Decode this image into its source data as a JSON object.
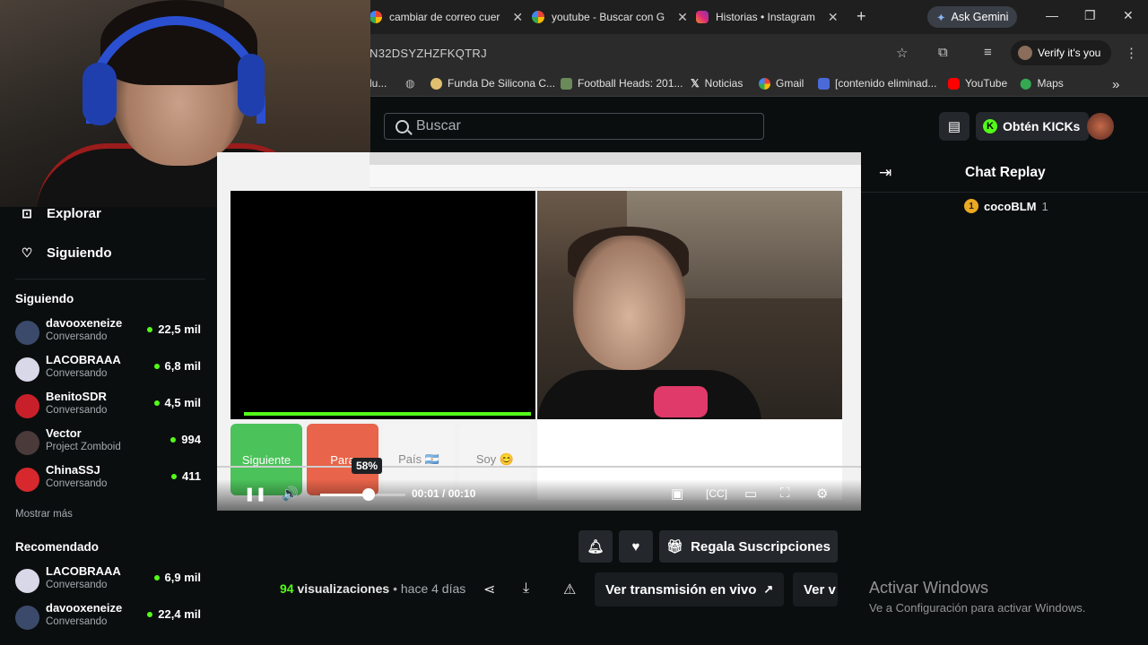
{
  "browser": {
    "tabs": [
      {
        "label": "cambiar de correo cuer",
        "color": "#ffffff"
      },
      {
        "label": "youtube - Buscar con G",
        "color": "#ffffff"
      },
      {
        "label": "Historias • Instagram",
        "color": "#e1306c"
      }
    ],
    "new_tab": "+",
    "gemini": "Ask Gemini",
    "url": "N32DSYZHZFKQTRJ",
    "verify": "Verify it's you",
    "bookmarks": [
      "lu...",
      "Funda De Silicona C...",
      "Football Heads: 201...",
      "Noticias",
      "Gmail",
      "[contenido eliminad...",
      "YouTube",
      "Maps"
    ],
    "bookmarks_more": "»"
  },
  "header": {
    "search_placeholder": "Buscar",
    "kicks_label": "Obtén KICKs",
    "kicks_icon": "K"
  },
  "sidebar": {
    "explore": "Explorar",
    "following_nav": "Siguiendo",
    "following_title": "Siguiendo",
    "following": [
      {
        "name": "davooxeneize",
        "category": "Conversando",
        "viewers": "22,5 mil",
        "color": "#3b4a6b"
      },
      {
        "name": "LACOBRAAA",
        "category": "Conversando",
        "viewers": "6,8 mil",
        "color": "#d8d8e8"
      },
      {
        "name": "BenitoSDR",
        "category": "Conversando",
        "viewers": "4,5 mil",
        "color": "#c8202a"
      },
      {
        "name": "Vector",
        "category": "Project Zomboid",
        "viewers": "994",
        "color": "#4a3a3a"
      },
      {
        "name": "ChinaSSJ",
        "category": "Conversando",
        "viewers": "411",
        "color": "#d6282d"
      }
    ],
    "more": "Mostrar más",
    "recommended_title": "Recomendado",
    "recommended": [
      {
        "name": "LACOBRAAA",
        "category": "Conversando",
        "viewers": "6,9 mil",
        "color": "#d8d8e8"
      },
      {
        "name": "davooxeneize",
        "category": "Conversando",
        "viewers": "22,4 mil",
        "color": "#3b4a6b"
      }
    ]
  },
  "player": {
    "buttons": [
      {
        "label": "Siguiente",
        "bg": "#4cc25a",
        "fg": "#ffffff"
      },
      {
        "label": "Para",
        "bg": "#e8644a",
        "fg": "#ffffff"
      },
      {
        "label": "País 🇦🇷",
        "bg": "#f4f4f4",
        "fg": "#888888"
      },
      {
        "label": "Soy 😊",
        "bg": "#f4f4f4",
        "fg": "#888888"
      }
    ],
    "volume_tip": "58%",
    "volume_level": 0.58,
    "time": "00:01 / 00:10"
  },
  "chat": {
    "title": "Chat Replay",
    "top_user": "cocoBLM",
    "top_count": "1"
  },
  "actions": {
    "gift": "Regala Suscripciones",
    "views_count": "94",
    "views_label": "visualizaciones",
    "dot": "•",
    "ago": "hace 4 días",
    "live": "Ver transmisión en vivo",
    "verv": "Ver v"
  },
  "windows": {
    "line1": "Activar Windows",
    "line2": "Ve a Configuración para activar Windows."
  },
  "accent": "#53fc18"
}
